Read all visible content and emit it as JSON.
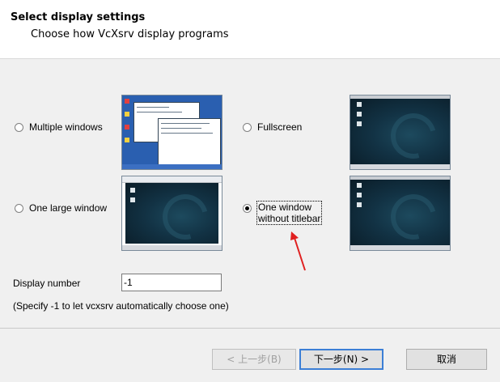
{
  "header": {
    "title": "Select display settings",
    "subtitle": "Choose how VcXsrv display programs"
  },
  "options": [
    {
      "label": "Multiple windows",
      "selected": false
    },
    {
      "label": "Fullscreen",
      "selected": false
    },
    {
      "label": "One large window",
      "selected": false
    },
    {
      "label_line1": "One window",
      "label_line2": "without titlebar",
      "selected": true
    }
  ],
  "display": {
    "label": "Display number",
    "value": "-1",
    "help": "(Specify -1 to let vcxsrv automatically choose one)"
  },
  "buttons": {
    "back": "< 上一步(B)",
    "next": "下一步(N) >",
    "cancel": "取消"
  },
  "colors": {
    "arrow": "#e02020",
    "default_button_border": "#3c7fd6"
  },
  "icons": {
    "annotation": "red-arrow-icon"
  }
}
